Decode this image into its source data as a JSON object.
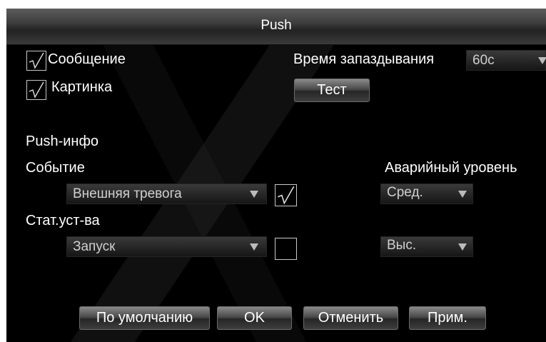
{
  "dialog": {
    "title": "Push",
    "message_label": "Сообщение",
    "message_checked": true,
    "picture_label": "Картинка",
    "picture_checked": true,
    "delay_label": "Время запаздывания",
    "delay_value": "60с",
    "test_button": "Тест",
    "push_info_label": "Push-инфо",
    "event": {
      "label": "Событие",
      "value": "Внешняя тревога",
      "checked": true
    },
    "alarm_level_label": "Аварийный уровень",
    "event_level_value": "Сред.",
    "device_status": {
      "label": "Стат.уст-ва",
      "value": "Запуск",
      "checked": false
    },
    "device_level_value": "Выс.",
    "buttons": {
      "default": "По умолчанию",
      "ok": "OK",
      "cancel": "Отменить",
      "apply": "Прим."
    }
  },
  "icons": {
    "checkmark": "checkmark-icon",
    "dropdown": "triangle-down-icon"
  },
  "colors": {
    "background": "#000000",
    "text": "#ffffff",
    "combo_text": "#cfcfcf"
  }
}
